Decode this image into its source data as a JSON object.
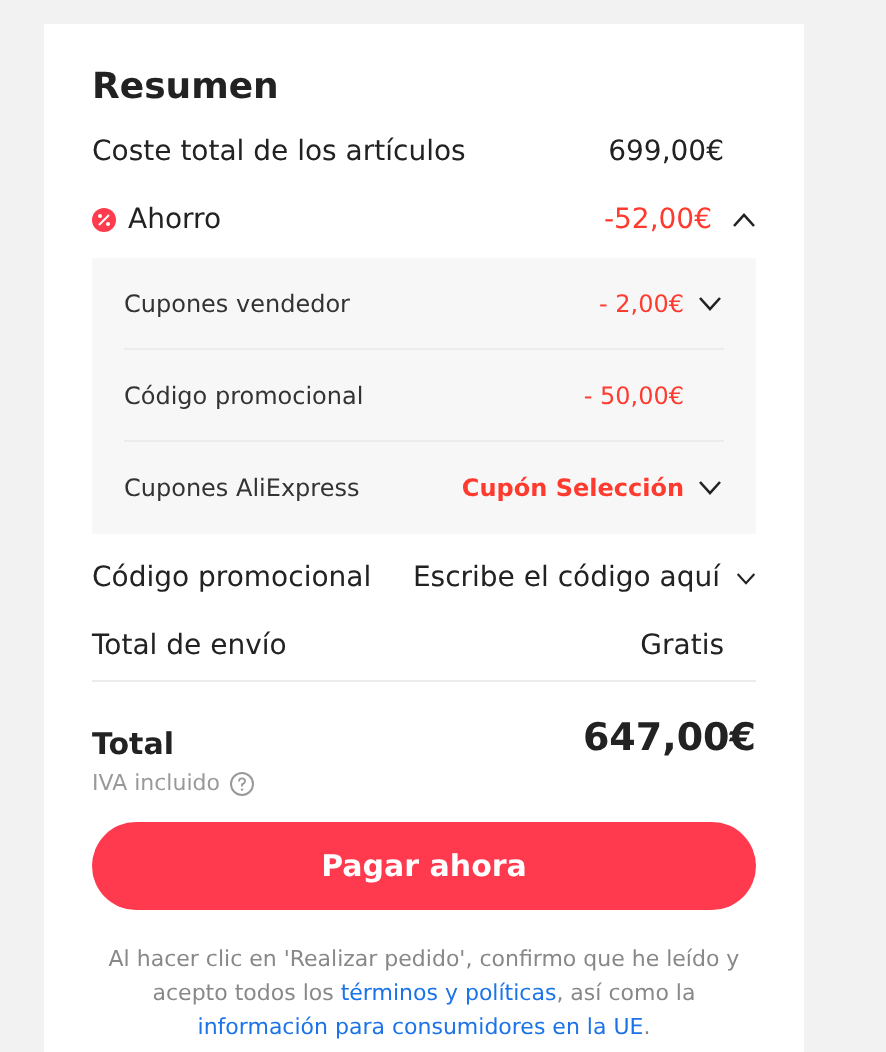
{
  "title": "Resumen",
  "items_cost": {
    "label": "Coste total de los artículos",
    "value": "699,00€"
  },
  "savings": {
    "label": "Ahorro",
    "value": "-52,00€",
    "expanded": true,
    "rows": [
      {
        "label": "Cupones vendedor",
        "value": "- 2,00€",
        "kind": "dropdown",
        "emphasis": false
      },
      {
        "label": "Código promocional",
        "value": "- 50,00€",
        "kind": "plain",
        "emphasis": false
      },
      {
        "label": "Cupones AliExpress",
        "value": "Cupón Selección",
        "kind": "dropdown",
        "emphasis": true
      }
    ]
  },
  "promo_code": {
    "label": "Código promocional",
    "placeholder": "Escribe el código aquí"
  },
  "shipping": {
    "label": "Total de envío",
    "value": "Gratis"
  },
  "total": {
    "label": "Total",
    "value": "647,00€",
    "note": "IVA incluido"
  },
  "pay_button": "Pagar ahora",
  "disclaimer": [
    {
      "kind": "text",
      "text": "Al hacer clic en 'Realizar pedido', confirmo que he leído y acepto todos los "
    },
    {
      "kind": "link",
      "text": "términos y políticas"
    },
    {
      "kind": "text",
      "text": ", así como la "
    },
    {
      "kind": "link",
      "text": "información para consumidores en la UE"
    },
    {
      "kind": "text",
      "text": "."
    }
  ]
}
